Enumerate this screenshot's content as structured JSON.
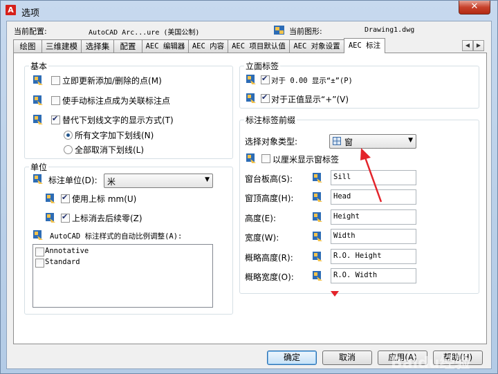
{
  "window": {
    "title": "选项",
    "app_icon_letter": "A",
    "close": "✕"
  },
  "header": {
    "config_label": "当前配置:",
    "config_value": "AutoCAD Arc...ure (美国公制)",
    "drawing_label": "当前图形:",
    "drawing_value": "Drawing1.dwg"
  },
  "tabs": [
    {
      "label": "绘图"
    },
    {
      "label": "三维建模"
    },
    {
      "label": "选择集"
    },
    {
      "label": "配置"
    },
    {
      "label": "AEC 编辑器"
    },
    {
      "label": "AEC 内容"
    },
    {
      "label": "AEC 项目默认值"
    },
    {
      "label": "AEC 对象设置"
    },
    {
      "label": "AEC 标注"
    }
  ],
  "tab_scroll": {
    "left": "◀",
    "right": "▶"
  },
  "basic": {
    "title": "基本",
    "opt1": "立即更新添加/删除的点(M)",
    "opt2": "使手动标注点成为关联标注点",
    "opt3": "替代下划线文字的显示方式(T)",
    "radio1": "所有文字加下划线(N)",
    "radio2": "全部取消下划线(L)"
  },
  "units": {
    "title": "单位",
    "unit_label": "标注单位(D):",
    "unit_value": "米",
    "superscript": "使用上标 mm(U)",
    "suppress": "上标消去后续零(Z)",
    "autoscale_label": "AutoCAD 标注样式的自动比例调整(A):",
    "styles": [
      "Annotative",
      "Standard"
    ]
  },
  "elevation": {
    "title": "立面标签",
    "opt1": "对于 0.00 显示“±”(P)",
    "opt2": "对于正值显示“+”(V)"
  },
  "prefix": {
    "title": "标注标签前缀",
    "type_label": "选择对象类型:",
    "type_value": "窗",
    "cm_label": "以厘米显示窗标签",
    "rows": [
      {
        "label": "窗台板高(S):",
        "value": "Sill"
      },
      {
        "label": "窗顶高度(H):",
        "value": "Head"
      },
      {
        "label": "高度(E):",
        "value": "Height"
      },
      {
        "label": "宽度(W):",
        "value": "Width"
      },
      {
        "label": "概略高度(R):",
        "value": "R.O. Height"
      },
      {
        "label": "概略宽度(O):",
        "value": "R.O. Width"
      }
    ]
  },
  "buttons": {
    "ok": "确定",
    "cancel": "取消",
    "apply": "应用(A)",
    "help": "帮助(H)"
  },
  "watermark": "Baidu经验",
  "colors": {
    "annotation_arrow": "#e3242b",
    "close_button": "#c7412b"
  }
}
